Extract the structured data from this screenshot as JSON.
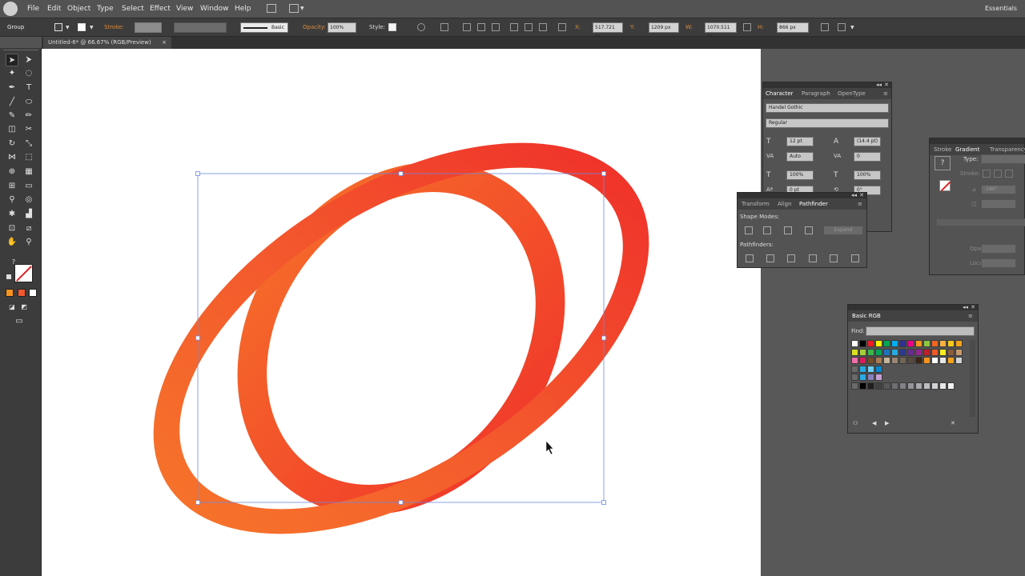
{
  "menubar": {
    "items": [
      "File",
      "Edit",
      "Object",
      "Type",
      "Select",
      "Effect",
      "View",
      "Window",
      "Help"
    ],
    "workspace": "Essentials"
  },
  "controlbar": {
    "selection": "Group",
    "stroke_label": "Stroke:",
    "brush_label": "Basic",
    "opacity_label": "Opacity:",
    "opacity_value": "100%",
    "style_label": "Style:",
    "x_label": "X:",
    "x_value": "517.721 px",
    "y_label": "Y:",
    "y_value": "1209 px",
    "w_label": "W:",
    "w_value": "1070.511 px",
    "h_label": "H:",
    "h_value": "866 px"
  },
  "document": {
    "tab_title": "Untitled-6* @ 66.67% (RGB/Preview)",
    "close_glyph": "×"
  },
  "tools": [
    "selection-tool",
    "direct-selection-tool",
    "magic-wand-tool",
    "lasso-tool",
    "pen-tool",
    "type-tool",
    "line-tool",
    "ellipse-tool",
    "paintbrush-tool",
    "pencil-tool",
    "eraser-tool",
    "scissors-tool",
    "rotate-tool",
    "scale-tool",
    "width-tool",
    "free-transform-tool",
    "shape-builder-tool",
    "perspective-grid-tool",
    "mesh-tool",
    "gradient-tool",
    "eyedropper-tool",
    "blend-tool",
    "symbol-sprayer-tool",
    "graph-tool",
    "artboard-tool",
    "slice-tool",
    "hand-tool",
    "zoom-tool"
  ],
  "colors": {
    "gradient_start": "#f7762a",
    "gradient_mid": "#f3572d",
    "gradient_end": "#ef2e2a",
    "selection": "#6e8ae0"
  },
  "character_panel": {
    "tabs": [
      "Character",
      "Paragraph",
      "OpenType"
    ],
    "font_family": "Handel Gothic",
    "font_style": "Regular",
    "font_size": "12 pt",
    "leading": "(14.4 pt)",
    "kerning": "Auto",
    "tracking": "0",
    "vertical_scale": "100%",
    "horizontal_scale": "100%",
    "baseline_shift": "0 pt",
    "rotation": "0°"
  },
  "pathfinder_panel": {
    "tabs": [
      "Transform",
      "Align",
      "Pathfinder"
    ],
    "shape_modes_label": "Shape Modes:",
    "expand_label": "Expand",
    "pathfinders_label": "Pathfinders:"
  },
  "gradient_panel": {
    "tabs": [
      "Stroke",
      "Gradient",
      "Transparency"
    ],
    "type_label": "Type:",
    "stroke_label": "Stroke:",
    "angle_value": "-180°",
    "opacity_label": "Opacity:",
    "location_label": "Location:"
  },
  "swatches_panel": {
    "title": "Basic RGB",
    "find_label": "Find:",
    "rows": [
      [
        "#ffffff",
        "#000000",
        "#ee1c25",
        "#fff200",
        "#00a651",
        "#00aeef",
        "#2e3192",
        "#ec008c",
        "#f7941d",
        "#8dc63f",
        "#f26522",
        "#fbb040",
        "#f8c91c",
        "#f7a21b"
      ],
      [
        "#d7df23",
        "#a6ce39",
        "#39b54a",
        "#00a651",
        "#1c75bc",
        "#27aae1",
        "#2b3990",
        "#662d91",
        "#92278f",
        "#be1e2d",
        "#f15a29",
        "#fcee21",
        "#8b5e3c",
        "#c49a6c"
      ],
      [
        "#f06eaa",
        "#da1c5c",
        "#754c29",
        "#a97c50",
        "#c2b59b",
        "#998675",
        "#726658",
        "#594a42",
        "#3c2415",
        "#f7941d",
        "#ffffff",
        "#e6e7e8",
        "#f7a21b",
        "#d1d3d4"
      ],
      [
        "#27aae1",
        "#6dcff6",
        "#0089cf"
      ],
      [
        "#29abe2",
        "#8781bd",
        "#c69fd5"
      ],
      [
        "#000000",
        "#231f20",
        "#414042",
        "#58595b",
        "#6d6e71",
        "#808285",
        "#939598",
        "#a7a9ac",
        "#bcbec0",
        "#d1d3d4",
        "#e6e7e8",
        "#f1f2f2"
      ]
    ]
  }
}
